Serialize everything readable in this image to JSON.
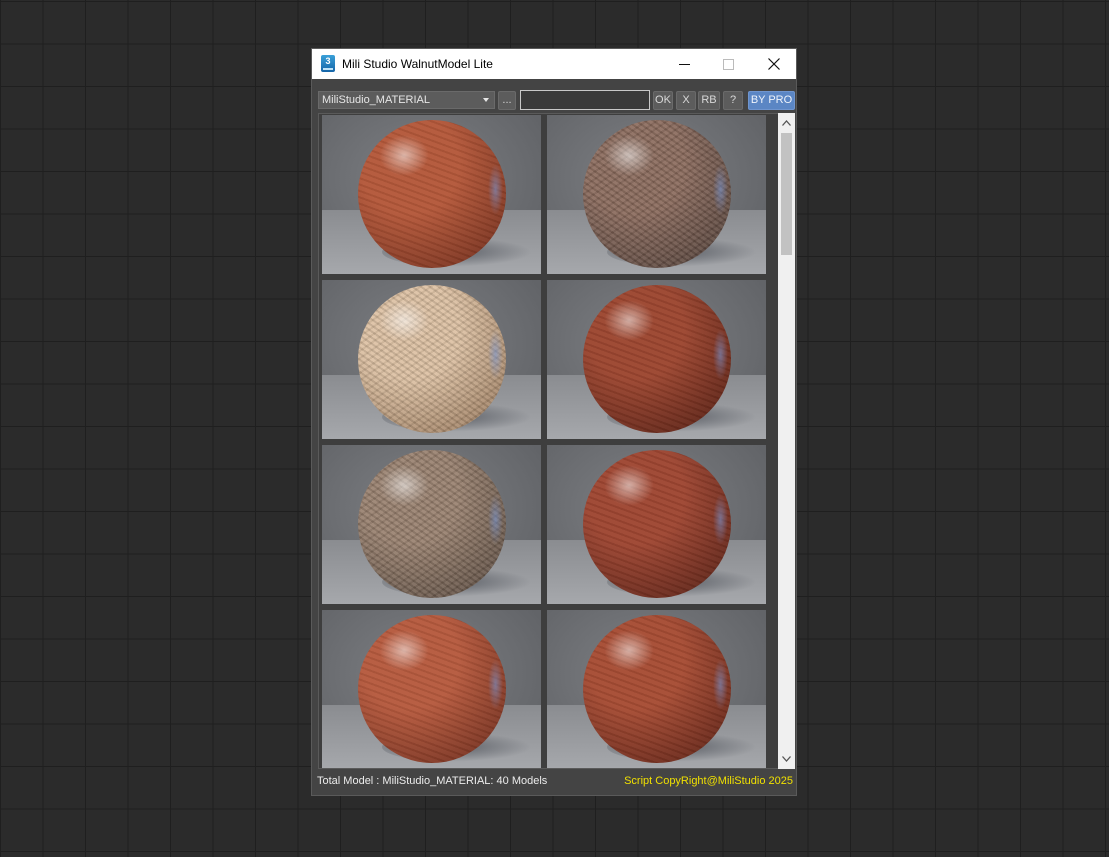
{
  "window": {
    "title": "Mili Studio WalnutModel Lite",
    "app_icon_label": "3"
  },
  "toolbar": {
    "library_select": "MiliStudio_MATERIAL",
    "browse_label": "...",
    "search_value": "",
    "ok_label": "OK",
    "x_label": "X",
    "rb_label": "RB",
    "help_label": "?",
    "bypro_label": "BY PRO"
  },
  "grid": {
    "columns": 2,
    "visible_rows": 4,
    "items": [
      {
        "color": "#b4583a",
        "shade": "#6a2a1a",
        "grain": "fine"
      },
      {
        "color": "#8a6a5c",
        "shade": "#4a3a34",
        "grain": "herringbone"
      },
      {
        "color": "#dcc0a2",
        "shade": "#8e6e52",
        "grain": "herringbone"
      },
      {
        "color": "#9c4630",
        "shade": "#4e1c12",
        "grain": "fine"
      },
      {
        "color": "#98806e",
        "shade": "#52443a",
        "grain": "herringbone"
      },
      {
        "color": "#9e4632",
        "shade": "#501e14",
        "grain": "fine"
      },
      {
        "color": "#b65a3e",
        "shade": "#66281a",
        "grain": "fine"
      },
      {
        "color": "#a64c34",
        "shade": "#561f14",
        "grain": "fine"
      }
    ]
  },
  "scroll": {
    "position_fraction": 0.0
  },
  "status": {
    "total_label": "Total Model : MiliStudio_MATERIAL: 40 Models",
    "copyright": "Script CopyRight@MiliStudio 2025"
  },
  "colors": {
    "accent": "#5b86c4",
    "copyright_yellow": "#f0e000",
    "panel": "#444444"
  }
}
